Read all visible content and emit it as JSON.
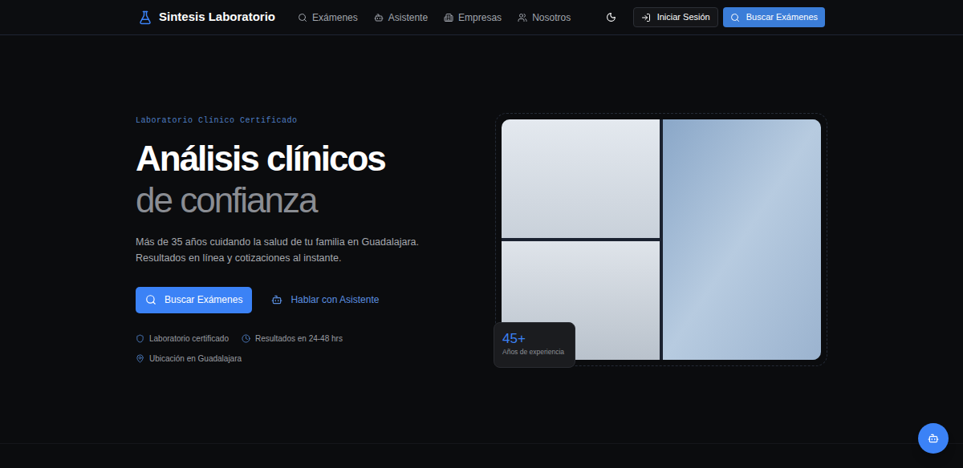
{
  "header": {
    "brand": "Sintesis Laboratorio",
    "nav": [
      {
        "label": "Exámenes",
        "icon": "search"
      },
      {
        "label": "Asistente",
        "icon": "bot"
      },
      {
        "label": "Empresas",
        "icon": "building"
      },
      {
        "label": "Nosotros",
        "icon": "users"
      }
    ],
    "login_button": "Iniciar Sesión",
    "search_button": "Buscar Exámenes"
  },
  "hero": {
    "eyebrow": "Laboratorio Clínico Certificado",
    "title_line1": "Análisis clínicos",
    "title_line2": "de confianza",
    "description_line1": "Más de 35 años cuidando la salud de tu familia en Guadalajara.",
    "description_line2": "Resultados en línea y cotizaciones al instante.",
    "primary_button": "Buscar Exámenes",
    "secondary_button": "Hablar con Asistente",
    "features": [
      {
        "label": "Laboratorio certificado",
        "icon": "shield"
      },
      {
        "label": "Resultados en 24-48 hrs",
        "icon": "clock"
      },
      {
        "label": "Ubicación en Guadalajara",
        "icon": "pin"
      }
    ]
  },
  "image_badge": {
    "value": "45+",
    "label": "Años de experiencia"
  }
}
